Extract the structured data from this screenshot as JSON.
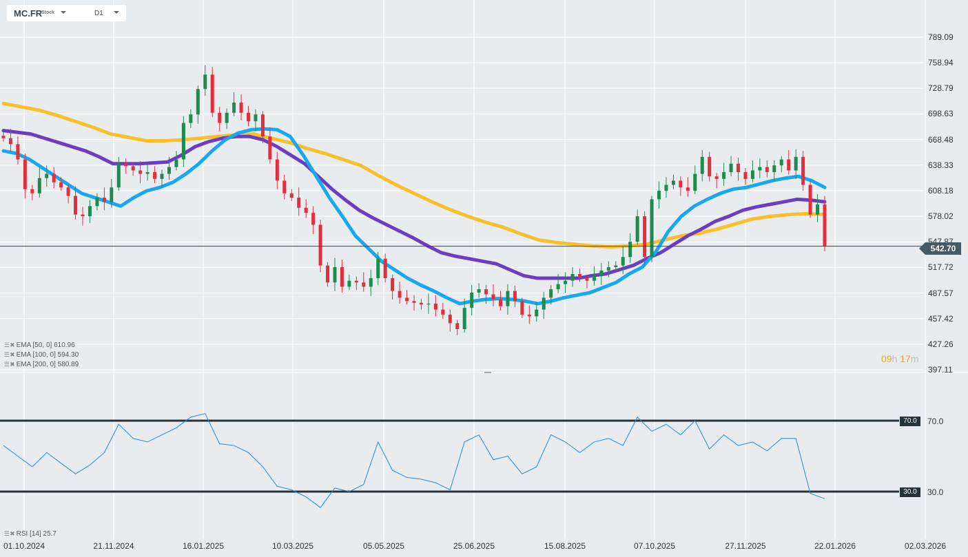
{
  "header": {
    "symbol": "MC.FR",
    "type": "Stock",
    "timeframe": "D1"
  },
  "indicators": [
    {
      "label": "EMA [50,  0]",
      "value": "610.96",
      "color": "#1aa7ee"
    },
    {
      "label": "EMA [100,  0]",
      "value": "594.30",
      "color": "#6a3fbf"
    },
    {
      "label": "EMA [200,  0]",
      "value": "580.89",
      "color": "#fbbf2c"
    }
  ],
  "rsi_legend": {
    "label": "RSI [14]",
    "value": "25.7"
  },
  "current_price": "542.70",
  "timer": {
    "hours": "09",
    "h": "h",
    "minutes": "17",
    "m": "m"
  },
  "price_axis": [
    "789.09",
    "758.94",
    "728.79",
    "698.63",
    "668.48",
    "638.33",
    "608.18",
    "578.02",
    "547.87",
    "517.72",
    "487.57",
    "457.42",
    "427.26",
    "397.11"
  ],
  "rsi_levels": [
    "70.0",
    "30.0"
  ],
  "date_axis": [
    "01.10.2024",
    "21.11.2024",
    "16.01.2025",
    "10.03.2025",
    "05.05.2025",
    "25.06.2025",
    "15.08.2025",
    "07.10.2025",
    "27.11.2025",
    "22.01.2026",
    "02.03.2026"
  ],
  "chart_data": {
    "type": "candlestick",
    "ylim": [
      397.11,
      789.09
    ],
    "closes": [
      670,
      663,
      645,
      610,
      605,
      623,
      628,
      618,
      612,
      602,
      580,
      578,
      590,
      600,
      595,
      612,
      640,
      637,
      632,
      628,
      630,
      622,
      628,
      636,
      645,
      688,
      698,
      728,
      745,
      700,
      688,
      700,
      712,
      700,
      690,
      698,
      672,
      645,
      620,
      605,
      600,
      588,
      582,
      568,
      520,
      500,
      518,
      495,
      502,
      500,
      495,
      505,
      528,
      505,
      490,
      482,
      478,
      476,
      474,
      475,
      468,
      462,
      452,
      445,
      470,
      488,
      492,
      486,
      480,
      472,
      490,
      478,
      462,
      460,
      468,
      482,
      492,
      498,
      502,
      510,
      505,
      502,
      508,
      514,
      518,
      520,
      530,
      548,
      578,
      530,
      598,
      608,
      615,
      620,
      612,
      608,
      628,
      648,
      625,
      622,
      630,
      640,
      630,
      622,
      632,
      636,
      630,
      638,
      645,
      632,
      648,
      615,
      580,
      592,
      542.7
    ],
    "ema50": [
      655,
      652,
      645,
      635,
      625,
      615,
      605,
      600,
      595,
      590,
      600,
      608,
      612,
      618,
      628,
      640,
      655,
      668,
      676,
      680,
      681,
      680,
      672,
      650,
      625,
      600,
      578,
      555,
      540,
      525,
      515,
      505,
      497,
      490,
      482,
      475,
      478,
      480,
      481,
      480,
      478,
      475,
      478,
      482,
      485,
      488,
      494,
      500,
      510,
      518,
      535,
      560,
      578,
      590,
      598,
      605,
      610,
      612,
      616,
      620,
      623,
      625,
      620,
      612
    ],
    "ema100": [
      679,
      677,
      675,
      670,
      665,
      660,
      655,
      648,
      640,
      640,
      640,
      641,
      642,
      650,
      660,
      666,
      670,
      672,
      672,
      668,
      660,
      650,
      640,
      625,
      610,
      597,
      585,
      576,
      568,
      560,
      552,
      543,
      535,
      531,
      528,
      525,
      522,
      515,
      508,
      505,
      505,
      505,
      505,
      508,
      510,
      515,
      520,
      528,
      535,
      545,
      555,
      563,
      572,
      578,
      585,
      589,
      592,
      595,
      598,
      597,
      595
    ],
    "ema200": [
      711,
      707,
      703,
      697,
      690,
      683,
      675,
      671,
      667,
      667,
      668,
      670,
      672,
      674,
      675,
      670,
      665,
      658,
      652,
      645,
      638,
      626,
      615,
      605,
      595,
      586,
      578,
      571,
      565,
      557,
      550,
      547,
      545,
      543,
      542,
      543,
      545,
      550,
      555,
      558,
      563,
      569,
      575,
      578,
      580,
      581,
      580
    ],
    "rsi": [
      56,
      50,
      44,
      52,
      46,
      40,
      45,
      52,
      68,
      60,
      58,
      62,
      66,
      72,
      74,
      57,
      56,
      52,
      44,
      33,
      31,
      27,
      21,
      32,
      30,
      34,
      58,
      42,
      38,
      37,
      35,
      31,
      58,
      62,
      48,
      50,
      40,
      44,
      62,
      58,
      52,
      58,
      60,
      56,
      72,
      64,
      68,
      62,
      70,
      54,
      62,
      56,
      58,
      53,
      60,
      60,
      29,
      26
    ],
    "rsi_ylim": [
      10,
      80
    ]
  }
}
